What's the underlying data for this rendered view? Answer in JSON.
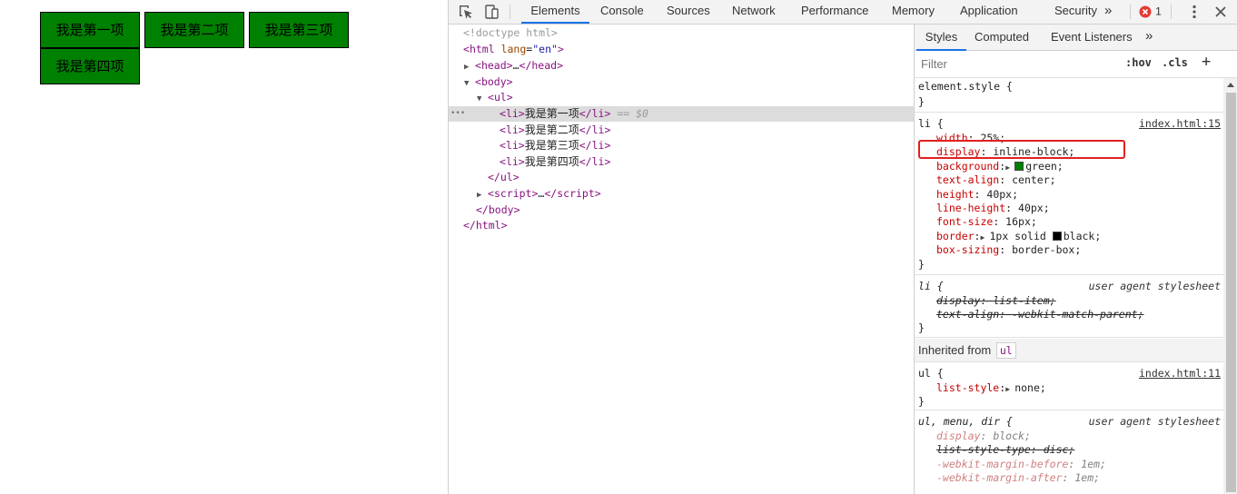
{
  "page": {
    "list_items": [
      "我是第一项",
      "我是第二项",
      "我是第三项",
      "我是第四项"
    ],
    "item_color": "#008000"
  },
  "devtools": {
    "tabs": [
      "Elements",
      "Console",
      "Sources",
      "Network",
      "Performance",
      "Memory",
      "Application",
      "Security"
    ],
    "active_tab": "Elements",
    "more_tabs_icon": "chevron-double-right-icon",
    "error_count": "1",
    "icons": [
      "inspect-element-icon",
      "device-toggle-icon",
      "error-icon",
      "more-vert-icon",
      "close-icon"
    ]
  },
  "elements": {
    "doctype": "<!doctype html>",
    "html_open_tag": "html",
    "lang_attr": "lang",
    "lang_value": "\"en\"",
    "head_tag": "head",
    "ellipsis": "…",
    "body_tag": "body",
    "ul_tag": "ul",
    "li_tag": "li",
    "li_items": [
      "我是第一项",
      "我是第二项",
      "我是第三项",
      "我是第四项"
    ],
    "selected_marker": "== $0",
    "script_tag": "script",
    "row_dots": "•••"
  },
  "styles": {
    "subtabs": [
      "Styles",
      "Computed",
      "Event Listeners"
    ],
    "active_subtab": "Styles",
    "filter_placeholder": "Filter",
    "hov_label": ":hov",
    "cls_label": ".cls",
    "add_label": "+",
    "element_style_selector": "element.style {",
    "close_brace": "}",
    "li_rule": {
      "selector": "li {",
      "source": "index.html:15",
      "declarations": [
        {
          "prop": "width",
          "value": "25%;"
        },
        {
          "prop": "display",
          "value": "inline-block;"
        },
        {
          "prop": "background",
          "value": "green;",
          "swatch": "#008000"
        },
        {
          "prop": "text-align",
          "value": "center;"
        },
        {
          "prop": "height",
          "value": "40px;"
        },
        {
          "prop": "line-height",
          "value": "40px;"
        },
        {
          "prop": "font-size",
          "value": "16px;"
        },
        {
          "prop": "border",
          "value": "1px solid ",
          "value2": "black;",
          "swatch": "#000000"
        },
        {
          "prop": "box-sizing",
          "value": "border-box;"
        }
      ]
    },
    "li_ua_rule": {
      "selector": "li {",
      "source": "user agent stylesheet",
      "declarations": [
        {
          "prop": "display",
          "value": "list-item;"
        },
        {
          "prop": "text-align",
          "value": "-webkit-match-parent;"
        }
      ]
    },
    "inherited_label": "Inherited from",
    "inherited_tag": "ul",
    "ul_rule": {
      "selector": "ul {",
      "source": "index.html:11",
      "declarations": [
        {
          "prop": "list-style",
          "value": "none;"
        }
      ]
    },
    "ul_ua_rule": {
      "selector": "ul, menu, dir {",
      "source": "user agent stylesheet",
      "declarations": [
        {
          "prop": "display",
          "value": "block;"
        },
        {
          "prop": "list-style-type",
          "value": "disc;"
        },
        {
          "prop": "-webkit-margin-before",
          "value": "1em;"
        },
        {
          "prop": "-webkit-margin-after",
          "value": "1em;"
        }
      ]
    }
  }
}
